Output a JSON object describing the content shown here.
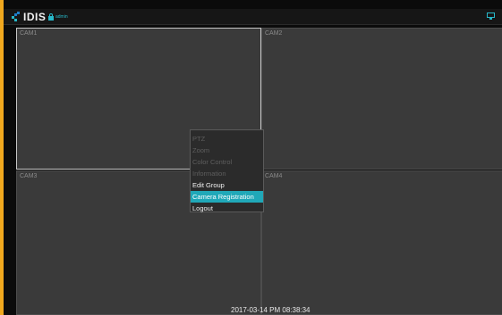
{
  "header": {
    "logo_text": "IDIS",
    "user_name": "admin",
    "icons": {
      "logo": "idis-logo-mark",
      "lock": "lock-icon",
      "monitor": "monitor-icon"
    }
  },
  "cameras": [
    {
      "label": "CAM1",
      "selected": true
    },
    {
      "label": "CAM2",
      "selected": false
    },
    {
      "label": "CAM3",
      "selected": false
    },
    {
      "label": "CAM4",
      "selected": false
    }
  ],
  "context_menu": {
    "items": [
      {
        "label": "PTZ",
        "state": "disabled"
      },
      {
        "label": "Zoom",
        "state": "disabled"
      },
      {
        "label": "Color Control",
        "state": "disabled"
      },
      {
        "label": "Information",
        "state": "disabled"
      },
      {
        "label": "Edit Group",
        "state": "enabled"
      },
      {
        "label": "Camera Registration",
        "state": "highlighted"
      },
      {
        "label": "Logout",
        "state": "enabled"
      }
    ]
  },
  "status": {
    "datetime": "2017-03-14 PM 08:38:34"
  },
  "colors": {
    "accent": "#20a8b8",
    "frame": "#f0a81e",
    "tile": "#3a3a3a",
    "menu_bg": "#2b2b2b"
  }
}
